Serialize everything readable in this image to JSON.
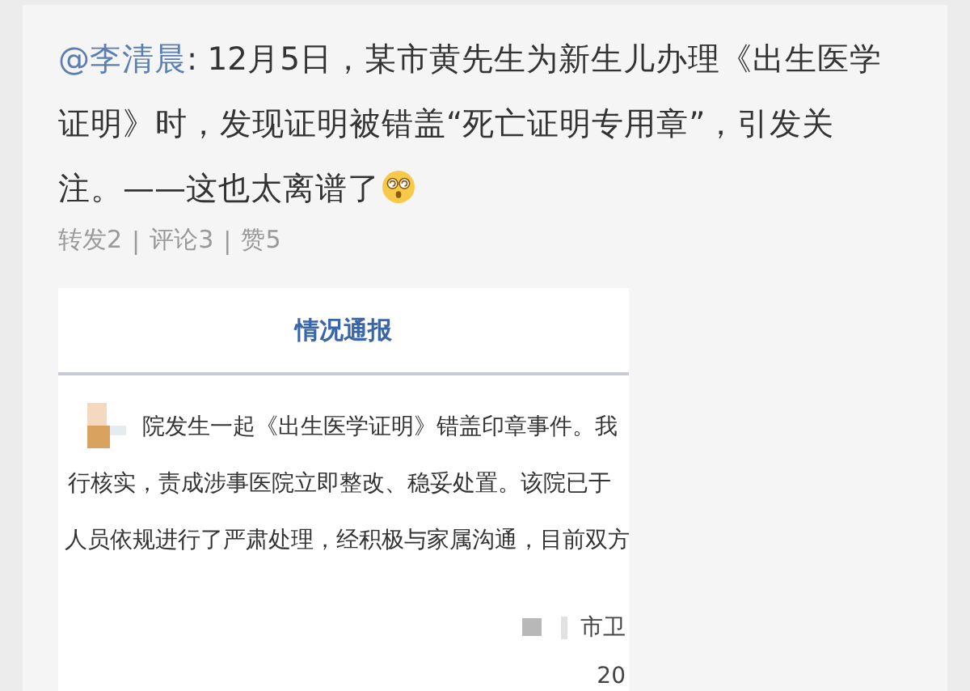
{
  "post": {
    "mention": "@李清晨",
    "text": ": 12月5日，某市黄先生为新生儿办理《出生医学证明》时，发现证明被错盖“死亡证明专用章”，引发关注。——这也太离谱了"
  },
  "stats": [
    {
      "label": "转发2"
    },
    {
      "label": "评论3"
    },
    {
      "label": "赞5"
    }
  ],
  "separator": "|",
  "document": {
    "title": "情况通报",
    "lines": [
      "院发生一起《出生医学证明》错盖印章事件。我",
      "行核实，责成涉事医院立即整改、稳妥处置。该院已于",
      "人员依规进行了严肃处理，经积极与家属沟通，目前双方"
    ],
    "signature": "市卫",
    "date": "20"
  }
}
